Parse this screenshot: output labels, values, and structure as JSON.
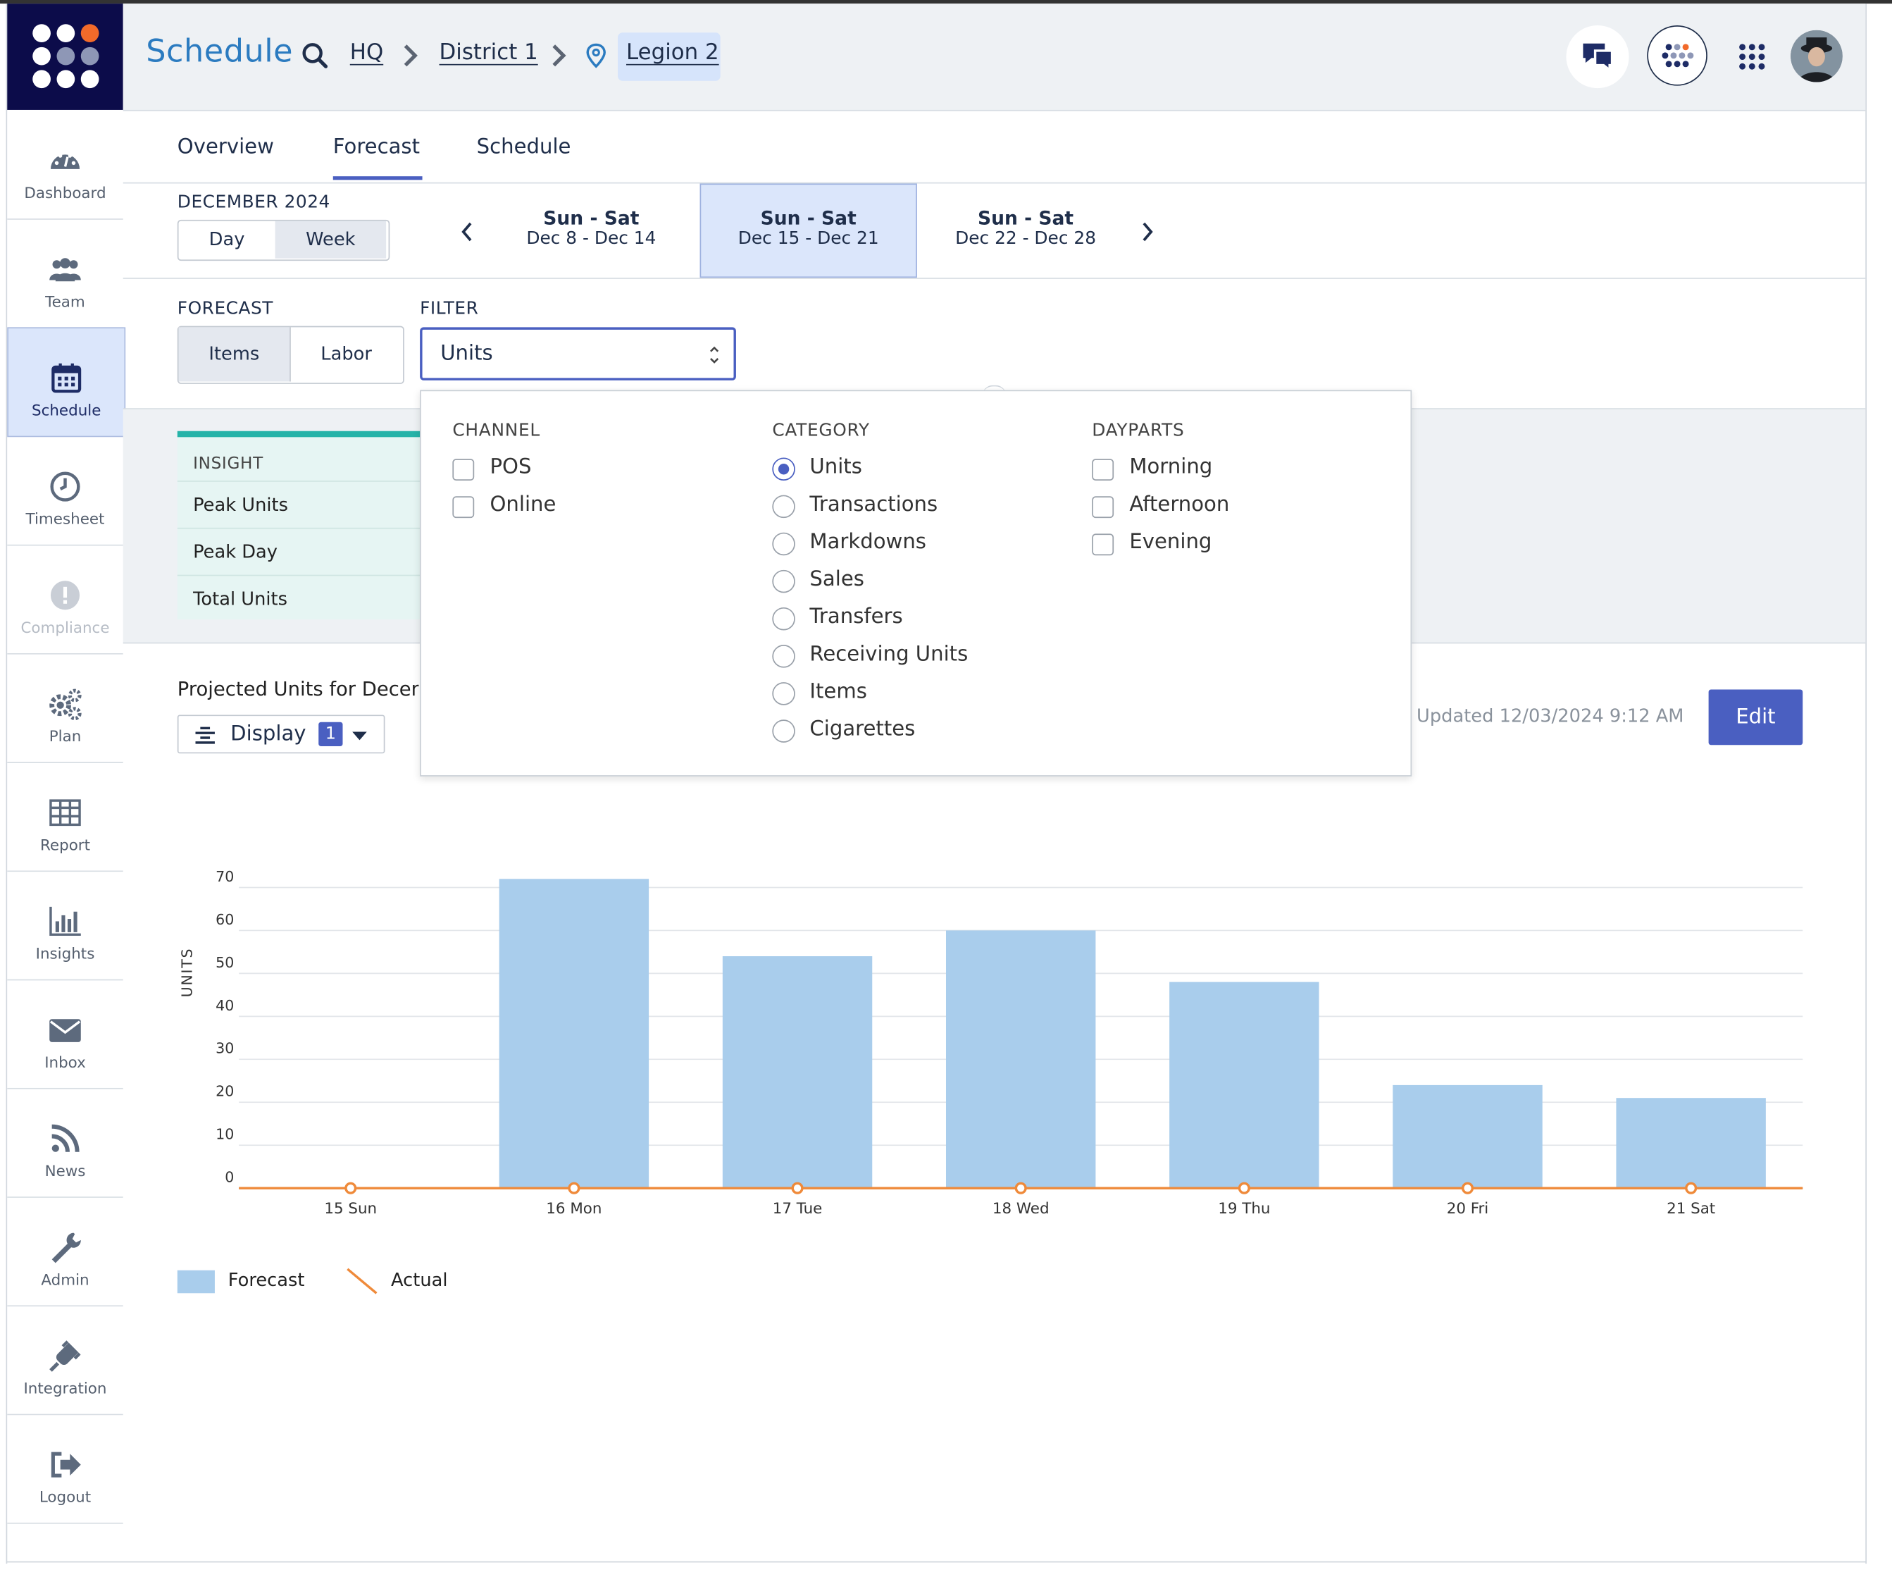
{
  "app": {
    "title": "Schedule"
  },
  "breadcrumb": {
    "items": [
      "HQ",
      "District 1",
      "Legion 2"
    ]
  },
  "sidebar": {
    "items": [
      {
        "label": "Dashboard",
        "icon": "dashboard-icon"
      },
      {
        "label": "Team",
        "icon": "team-icon"
      },
      {
        "label": "Schedule",
        "icon": "calendar-icon",
        "selected": true
      },
      {
        "label": "Timesheet",
        "icon": "clock-icon"
      },
      {
        "label": "Compliance",
        "icon": "alert-icon",
        "disabled": true
      },
      {
        "label": "Plan",
        "icon": "gears-icon"
      },
      {
        "label": "Report",
        "icon": "table-icon"
      },
      {
        "label": "Insights",
        "icon": "bar-chart-icon"
      },
      {
        "label": "Inbox",
        "icon": "envelope-icon"
      },
      {
        "label": "News",
        "icon": "rss-icon"
      },
      {
        "label": "Admin",
        "icon": "wrench-icon"
      },
      {
        "label": "Integration",
        "icon": "plug-icon"
      },
      {
        "label": "Logout",
        "icon": "logout-icon"
      }
    ]
  },
  "tabs": [
    {
      "label": "Overview"
    },
    {
      "label": "Forecast",
      "active": true
    },
    {
      "label": "Schedule"
    }
  ],
  "period": {
    "month": "DECEMBER 2024",
    "toggle": [
      "Day",
      "Week"
    ],
    "toggle_selected": "Week",
    "weeks": [
      {
        "line1": "Sun - Sat",
        "line2": "Dec 8 - Dec 14"
      },
      {
        "line1": "Sun - Sat",
        "line2": "Dec 15 - Dec 21",
        "selected": true
      },
      {
        "line1": "Sun - Sat",
        "line2": "Dec 22 - Dec 28"
      }
    ]
  },
  "forecast": {
    "caption": "FORECAST",
    "toggle": [
      "Items",
      "Labor"
    ],
    "toggle_selected": "Items"
  },
  "filter": {
    "caption": "FILTER",
    "value": "Units",
    "channel": {
      "caption": "CHANNEL",
      "options": [
        "POS",
        "Online"
      ]
    },
    "category": {
      "caption": "CATEGORY",
      "options": [
        "Units",
        "Transactions",
        "Markdowns",
        "Sales",
        "Transfers",
        "Receiving Units",
        "Items",
        "Cigarettes"
      ],
      "selected": "Units"
    },
    "dayparts": {
      "caption": "DAYPARTS",
      "options": [
        "Morning",
        "Afternoon",
        "Evening"
      ]
    }
  },
  "insight": {
    "header": "INSIGHT",
    "rows": [
      "Peak Units",
      "Peak Day",
      "Total Units"
    ]
  },
  "projection": {
    "title": "Projected Units for Decen",
    "display_label": "Display",
    "display_count": "1",
    "updated": "Updated 12/03/2024 9:12 AM",
    "edit_label": "Edit"
  },
  "colors": {
    "forecast_bar": "#a9cdec",
    "actual_line": "#ef8a3a",
    "primary_button": "#4a5fc1",
    "brand_title": "#2b7bc0",
    "logo_bg": "#0c0c4a"
  },
  "chart_data": {
    "type": "bar",
    "ylabel": "UNITS",
    "ylim": [
      0,
      70
    ],
    "yticks": [
      0,
      10,
      20,
      30,
      40,
      50,
      60,
      70
    ],
    "categories": [
      "15 Sun",
      "16 Mon",
      "17 Tue",
      "18 Wed",
      "19 Thu",
      "20 Fri",
      "21 Sat"
    ],
    "series": [
      {
        "name": "Forecast",
        "kind": "bar",
        "values": [
          0,
          72,
          54,
          60,
          48,
          24,
          21
        ]
      },
      {
        "name": "Actual",
        "kind": "line",
        "values": [
          0,
          0,
          0,
          0,
          0,
          0,
          0
        ]
      }
    ],
    "legend": "bottom-left",
    "grid": true
  }
}
